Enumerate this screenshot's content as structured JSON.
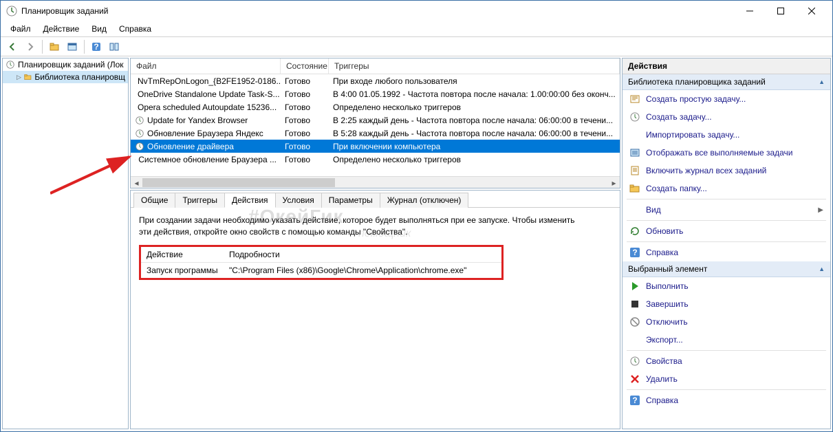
{
  "window": {
    "title": "Планировщик заданий"
  },
  "menu": {
    "file": "Файл",
    "action": "Действие",
    "view": "Вид",
    "help": "Справка"
  },
  "tree": {
    "root": "Планировщик заданий (Лок",
    "child": "Библиотека планировщ"
  },
  "tasklist": {
    "headers": {
      "file": "Файл",
      "state": "Состояние",
      "triggers": "Триггеры"
    },
    "rows": [
      {
        "name": "NvTmRepOnLogon_{B2FE1952-0186...",
        "state": "Готово",
        "trigger": "При входе любого пользователя"
      },
      {
        "name": "OneDrive Standalone Update Task-S...",
        "state": "Готово",
        "trigger": "В 4:00 01.05.1992 - Частота повтора после начала: 1.00:00:00 без оконч..."
      },
      {
        "name": "Opera scheduled Autoupdate 15236...",
        "state": "Готово",
        "trigger": "Определено несколько триггеров"
      },
      {
        "name": "Update for Yandex Browser",
        "state": "Готово",
        "trigger": "В 2:25 каждый день - Частота повтора после начала: 06:00:00 в течени..."
      },
      {
        "name": "Обновление Браузера Яндекс",
        "state": "Готово",
        "trigger": "В 5:28 каждый день - Частота повтора после начала: 06:00:00 в течени..."
      },
      {
        "name": "Обновление драйвера",
        "state": "Готово",
        "trigger": "При включении компьютера",
        "selected": true
      },
      {
        "name": "Системное обновление Браузера ...",
        "state": "Готово",
        "trigger": "Определено несколько триггеров"
      }
    ]
  },
  "tabs": {
    "general": "Общие",
    "triggers": "Триггеры",
    "actions": "Действия",
    "conditions": "Условия",
    "params": "Параметры",
    "journal": "Журнал (отключен)"
  },
  "detail": {
    "hint": "При создании задачи необходимо указать действие, которое будет выполняться при ее запуске.  Чтобы изменить эти действия, откройте окно свойств с помощью команды \"Свойства\".",
    "action_hdr": "Действие",
    "details_hdr": "Подробности",
    "action_val": "Запуск программы",
    "details_val": "\"C:\\Program Files (x86)\\Google\\Chrome\\Application\\chrome.exe\""
  },
  "actionspane": {
    "title": "Действия",
    "section1": "Библиотека планировщика заданий",
    "items1": [
      {
        "icon": "wizard",
        "label": "Создать простую задачу..."
      },
      {
        "icon": "task",
        "label": "Создать задачу..."
      },
      {
        "icon": "none",
        "label": "Импортировать задачу..."
      },
      {
        "icon": "showall",
        "label": "Отображать все выполняемые задачи"
      },
      {
        "icon": "log",
        "label": "Включить журнал всех заданий"
      },
      {
        "icon": "folder",
        "label": "Создать папку..."
      },
      {
        "icon": "none",
        "label": "Вид",
        "expand": true
      },
      {
        "icon": "refresh",
        "label": "Обновить"
      },
      {
        "icon": "help",
        "label": "Справка"
      }
    ],
    "section2": "Выбранный элемент",
    "items2": [
      {
        "icon": "run",
        "label": "Выполнить"
      },
      {
        "icon": "stop",
        "label": "Завершить"
      },
      {
        "icon": "disable",
        "label": "Отключить"
      },
      {
        "icon": "none",
        "label": "Экспорт..."
      },
      {
        "icon": "props",
        "label": "Свойства"
      },
      {
        "icon": "delete",
        "label": "Удалить"
      },
      {
        "icon": "help",
        "label": "Справка"
      }
    ]
  }
}
